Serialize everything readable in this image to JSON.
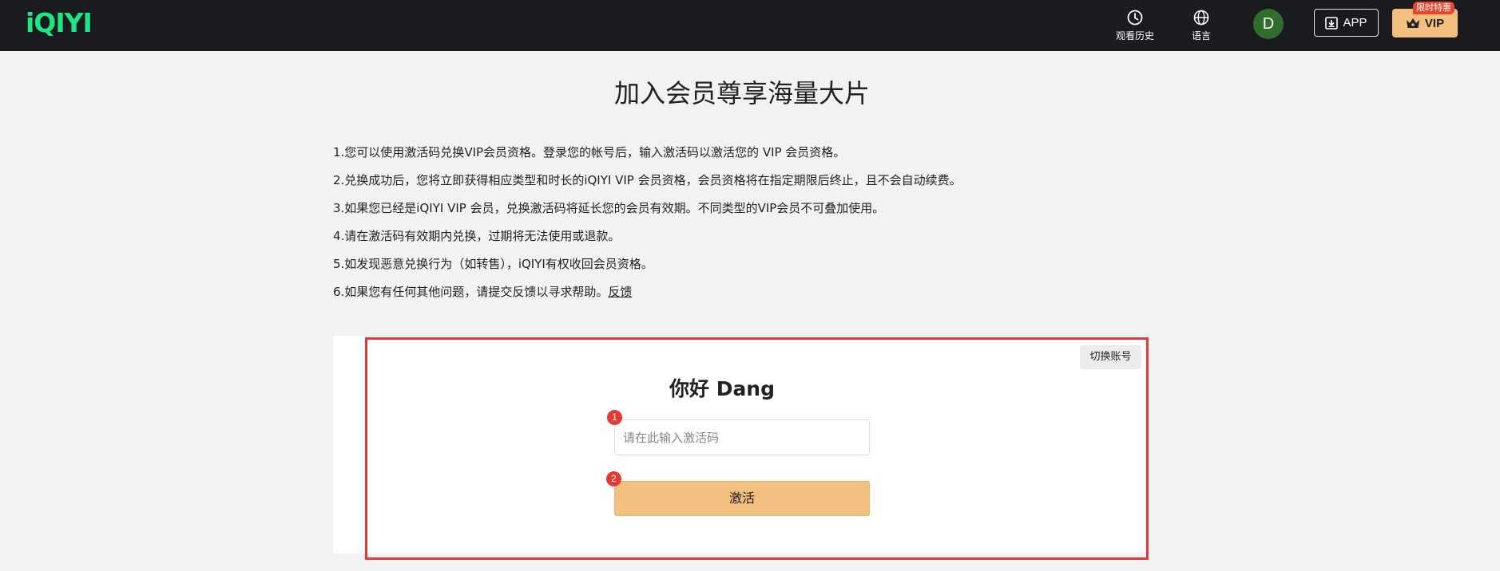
{
  "header": {
    "logo": "iQIYI",
    "history_label": "观看历史",
    "language_label": "语言",
    "avatar_letter": "D",
    "app_label": "APP",
    "vip_label": "VIP",
    "promo_badge": "限时特惠"
  },
  "main": {
    "title": "加入会员尊享海量大片",
    "rules": [
      "1.您可以使用激活码兑换VIP会员资格。登录您的帐号后，输入激活码以激活您的 VIP 会员资格。",
      "2.兑换成功后，您将立即获得相应类型和时长的iQIYI VIP 会员资格，会员资格将在指定期限后终止，且不会自动续费。",
      "3.如果您已经是iQIYI VIP 会员，兑换激活码将延长您的会员有效期。不同类型的VIP会员不可叠加使用。",
      "4.请在激活码有效期内兑换，过期将无法使用或退款。",
      "5.如发现恶意兑换行为（如转售），iQIYI有权收回会员资格。",
      "6.如果您有任何其他问题，请提交反馈以寻求帮助。"
    ],
    "feedback_link": "反馈"
  },
  "redeem": {
    "switch_account": "切换账号",
    "greeting": "你好 Dang",
    "input_placeholder": "请在此输入激活码",
    "input_value": "",
    "activate_label": "激活",
    "step1": "1",
    "step2": "2"
  },
  "colors": {
    "header_bg": "#1a1b1f",
    "brand_green": "#1ce783",
    "vip_gold": "#f2bf7f",
    "highlight_red": "#e53935",
    "avatar_green": "#2f6e2b"
  },
  "icons": {
    "history": "clock-icon",
    "language": "globe-icon",
    "app": "download-icon",
    "vip": "crown-icon"
  }
}
